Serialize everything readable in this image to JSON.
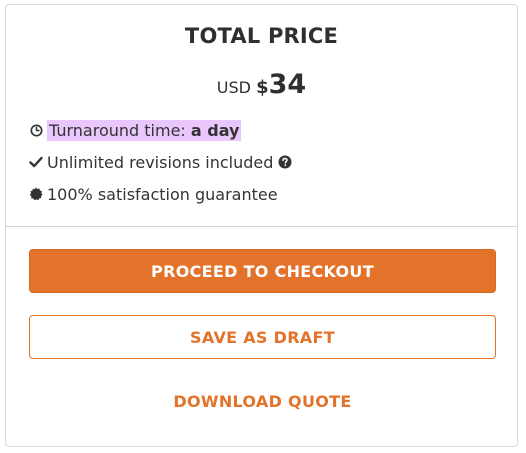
{
  "card": {
    "title": "TOTAL PRICE",
    "price": {
      "currency": "USD",
      "symbol": "$",
      "amount": "34"
    },
    "features": {
      "turnaround_prefix": "Turnaround time: ",
      "turnaround_value": "a day",
      "revisions": "Unlimited revisions included",
      "guarantee": "100% satisfaction guarantee"
    },
    "buttons": {
      "checkout": "PROCEED TO CHECKOUT",
      "draft": "SAVE AS DRAFT",
      "download": "DOWNLOAD QUOTE"
    }
  },
  "colors": {
    "accent": "#e3732a",
    "highlight": "#e9c6fb",
    "text": "#2f2f2f"
  },
  "icons": {
    "turnaround": "clock-icon",
    "revisions": "checkmark-icon",
    "revisions_help": "question-circle-icon",
    "guarantee": "badge-seal-icon"
  }
}
